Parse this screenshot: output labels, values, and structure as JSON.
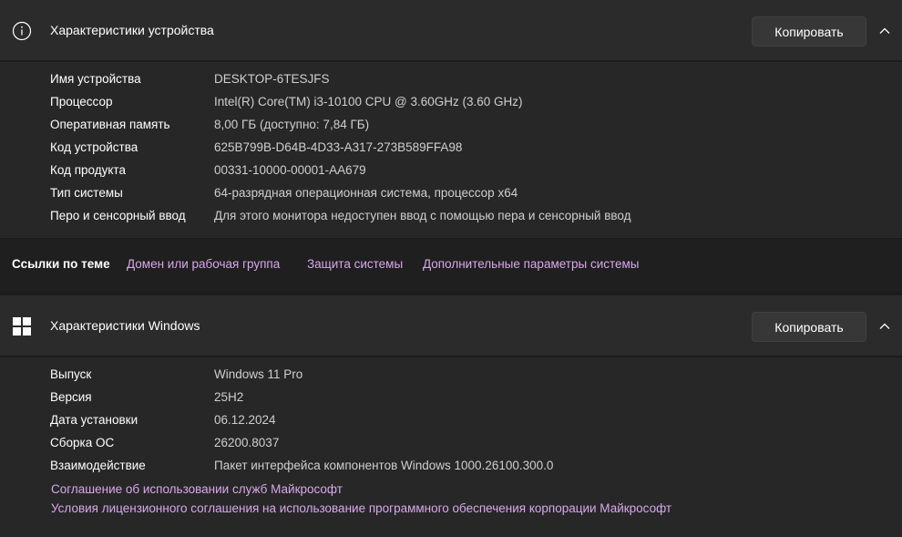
{
  "device": {
    "title": "Характеристики устройства",
    "copy_label": "Копировать",
    "icon": "info-icon",
    "rows": [
      {
        "label": "Имя устройства",
        "value": "DESKTOP-6TESJFS"
      },
      {
        "label": "Процессор",
        "value": "Intel(R) Core(TM) i3-10100 CPU @ 3.60GHz (3.60 GHz)"
      },
      {
        "label": "Оперативная память",
        "value": "8,00 ГБ (доступно: 7,84 ГБ)"
      },
      {
        "label": "Код устройства",
        "value": "625B799B-D64B-4D33-A317-273B589FFA98"
      },
      {
        "label": "Код продукта",
        "value": "00331-10000-00001-AA679"
      },
      {
        "label": "Тип системы",
        "value": "64-разрядная операционная система, процессор x64"
      },
      {
        "label": "Перо и сенсорный ввод",
        "value": "Для этого монитора недоступен ввод с помощью пера и сенсорный ввод"
      }
    ]
  },
  "related": {
    "title": "Ссылки по теме",
    "links": [
      {
        "label": "Домен или рабочая группа"
      },
      {
        "label": "Защита системы"
      },
      {
        "label": "Дополнительные параметры системы"
      }
    ]
  },
  "windows": {
    "title": "Характеристики Windows",
    "copy_label": "Копировать",
    "icon": "windows-logo-icon",
    "rows": [
      {
        "label": "Выпуск",
        "value": "Windows 11 Pro"
      },
      {
        "label": "Версия",
        "value": "25H2"
      },
      {
        "label": "Дата установки",
        "value": "06.12.2024"
      },
      {
        "label": "Сборка ОС",
        "value": "26200.8037"
      },
      {
        "label": "Взаимодействие",
        "value": "Пакет интерфейса компонентов Windows 1000.26100.300.0"
      }
    ],
    "links": [
      {
        "label": "Соглашение об использовании служб Майкрософт"
      },
      {
        "label": "Условия лицензионного соглашения на использование программного обеспечения корпорации Майкрософт"
      }
    ]
  },
  "colors": {
    "background": "#1c1c1c",
    "header": "#2b2b2b",
    "link": "#d8a8ec"
  }
}
